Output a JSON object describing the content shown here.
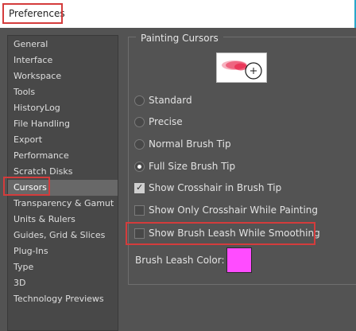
{
  "window": {
    "title": "Preferences"
  },
  "nav": {
    "items": [
      "General",
      "Interface",
      "Workspace",
      "Tools",
      "HistoryLog",
      "File Handling",
      "Export",
      "Performance",
      "Scratch Disks",
      "Cursors",
      "Transparency & Gamut",
      "Units & Rulers",
      "Guides, Grid & Slices",
      "Plug-Ins",
      "Type",
      "3D",
      "Technology Previews"
    ],
    "selected": "Cursors"
  },
  "painting_cursors": {
    "title": "Painting Cursors",
    "options": {
      "standard": {
        "label": "Standard",
        "selected": false
      },
      "precise": {
        "label": "Precise",
        "selected": false
      },
      "normal_tip": {
        "label": "Normal Brush Tip",
        "selected": false
      },
      "full_tip": {
        "label": "Full Size Brush Tip",
        "selected": true
      }
    },
    "checks": {
      "crosshair": {
        "label": "Show Crosshair in Brush Tip",
        "checked": true
      },
      "only_crosshair": {
        "label": "Show Only Crosshair While Painting",
        "checked": false
      },
      "leash": {
        "label": "Show Brush Leash While Smoothing",
        "checked": false
      }
    },
    "leash_color": {
      "label": "Brush Leash Color:",
      "value": "#ff4cff"
    }
  },
  "colors": {
    "highlight": "#d43c3c",
    "preview_stroke": "#e8254a"
  }
}
